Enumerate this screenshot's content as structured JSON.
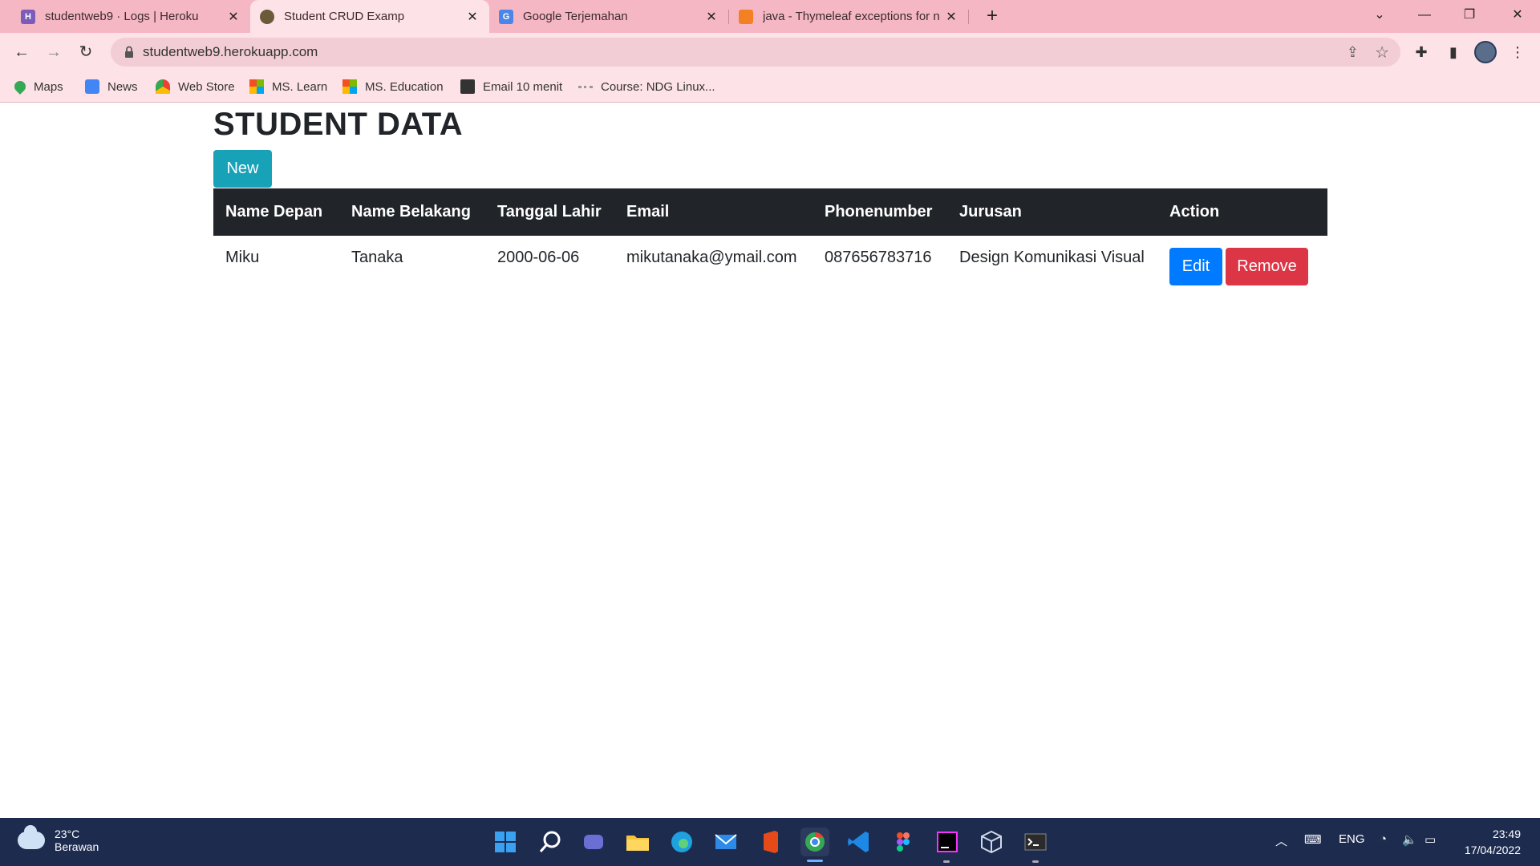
{
  "browser": {
    "tabs": [
      {
        "title": "studentweb9 · Logs | Heroku",
        "active": false
      },
      {
        "title": "Student CRUD Examp",
        "active": true
      },
      {
        "title": "Google Terjemahan",
        "active": false
      },
      {
        "title": "java - Thymeleaf exceptions for n",
        "active": false
      }
    ],
    "url": "studentweb9.herokuapp.com",
    "bookmarks": [
      "Maps",
      "News",
      "Web Store",
      "MS. Learn",
      "MS. Education",
      "Email 10 menit",
      "Course: NDG Linux..."
    ]
  },
  "page": {
    "title": "STUDENT DATA",
    "new_button": "New",
    "table": {
      "headers": [
        "Name Depan",
        "Name Belakang",
        "Tanggal Lahir",
        "Email",
        "Phonenumber",
        "Jurusan",
        "Action"
      ],
      "rows": [
        {
          "first": "Miku",
          "last": "Tanaka",
          "dob": "2000-06-06",
          "email": "mikutanaka@ymail.com",
          "phone": "087656783716",
          "major": "Design Komunikasi Visual",
          "edit": "Edit",
          "remove": "Remove"
        }
      ]
    }
  },
  "taskbar": {
    "weather": {
      "temp": "23°C",
      "condition": "Berawan"
    },
    "language": "ENG",
    "time": "23:49",
    "date": "17/04/2022"
  }
}
